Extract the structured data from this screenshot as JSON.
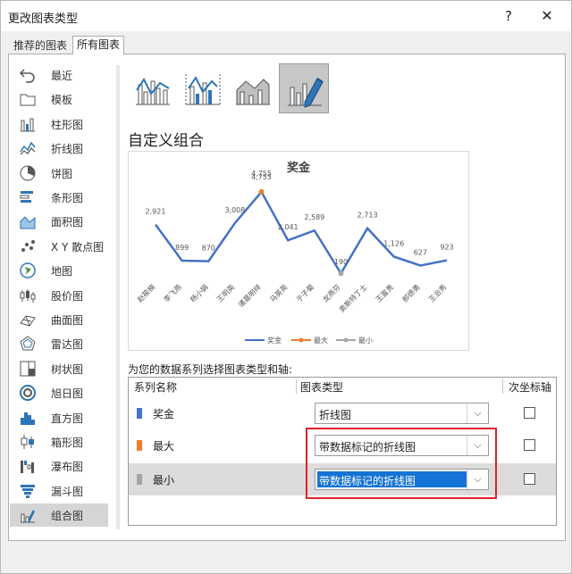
{
  "window": {
    "title": "更改图表类型",
    "help_glyph": "?",
    "close_glyph": "✕"
  },
  "tabs": [
    {
      "label": "推荐的图表",
      "selected": false
    },
    {
      "label": "所有图表",
      "selected": true
    }
  ],
  "sidebar": {
    "items": [
      {
        "label": "最近",
        "icon": "undo-icon"
      },
      {
        "label": "模板",
        "icon": "folder-icon"
      },
      {
        "label": "柱形图",
        "icon": "column-chart-icon"
      },
      {
        "label": "折线图",
        "icon": "line-chart-icon"
      },
      {
        "label": "饼图",
        "icon": "pie-chart-icon"
      },
      {
        "label": "条形图",
        "icon": "bar-chart-icon"
      },
      {
        "label": "面积图",
        "icon": "area-chart-icon"
      },
      {
        "label": "X Y 散点图",
        "icon": "scatter-chart-icon"
      },
      {
        "label": "地图",
        "icon": "map-chart-icon"
      },
      {
        "label": "股价图",
        "icon": "stock-chart-icon"
      },
      {
        "label": "曲面图",
        "icon": "surface-chart-icon"
      },
      {
        "label": "雷达图",
        "icon": "radar-chart-icon"
      },
      {
        "label": "树状图",
        "icon": "treemap-chart-icon"
      },
      {
        "label": "旭日图",
        "icon": "sunburst-chart-icon"
      },
      {
        "label": "直方图",
        "icon": "histogram-chart-icon"
      },
      {
        "label": "箱形图",
        "icon": "box-whisker-chart-icon"
      },
      {
        "label": "瀑布图",
        "icon": "waterfall-chart-icon"
      },
      {
        "label": "漏斗图",
        "icon": "funnel-chart-icon"
      },
      {
        "label": "组合图",
        "icon": "combo-chart-icon",
        "selected": true
      }
    ]
  },
  "combo_types": [
    {
      "icon": "clustered-column-line-icon",
      "selected": false
    },
    {
      "icon": "clustered-column-line-secondary-axis-icon",
      "selected": false
    },
    {
      "icon": "stacked-area-clustered-column-icon",
      "selected": false
    },
    {
      "icon": "custom-combination-icon",
      "selected": true
    }
  ],
  "section_title": "自定义组合",
  "chart_data": {
    "type": "line",
    "title": "奖金",
    "categories": [
      "赵筱楠",
      "李飞燕",
      "杨小娟",
      "王明英",
      "诸葛明祥",
      "马英英",
      "于子菊",
      "龙燕芬",
      "奥斯特丁士",
      "王富贵",
      "郝德勇",
      "王治秀"
    ],
    "series": [
      {
        "name": "奖金",
        "values": [
          2921,
          899,
          870,
          3008,
          4755,
          2041,
          2589,
          190,
          2713,
          1126,
          627,
          923
        ],
        "color": "#4472c4"
      },
      {
        "name": "最大",
        "values": [
          null,
          null,
          null,
          null,
          4755,
          null,
          null,
          null,
          null,
          null,
          null,
          null
        ],
        "color": "#ed7d31"
      },
      {
        "name": "最小",
        "values": [
          null,
          null,
          null,
          null,
          null,
          null,
          null,
          190,
          null,
          null,
          null,
          null
        ],
        "color": "#a5a5a5"
      }
    ],
    "data_labels": [
      "2,921",
      "899",
      "870",
      "3,008",
      "4,755",
      "2,041",
      "2,589",
      "190",
      "2,713",
      "1,126",
      "627",
      "923"
    ],
    "extra_label": "4,755",
    "legend": [
      "奖金",
      "最大",
      "最小"
    ],
    "legend_position": "bottom",
    "grid": false
  },
  "axis_prompt": "为您的数据系列选择图表类型和轴:",
  "grid": {
    "headers": {
      "name": "系列名称",
      "type": "图表类型",
      "axis": "次坐标轴"
    },
    "rows": [
      {
        "name": "奖金",
        "chart_type": "折线图",
        "secondary_axis": false,
        "color": "#4472c4"
      },
      {
        "name": "最大",
        "chart_type": "带数据标记的折线图",
        "secondary_axis": false,
        "color": "#ed7d31"
      },
      {
        "name": "最小",
        "chart_type": "带数据标记的折线图",
        "secondary_axis": false,
        "color": "#a5a5a5"
      }
    ],
    "dropdown_glyph": "⌵"
  }
}
